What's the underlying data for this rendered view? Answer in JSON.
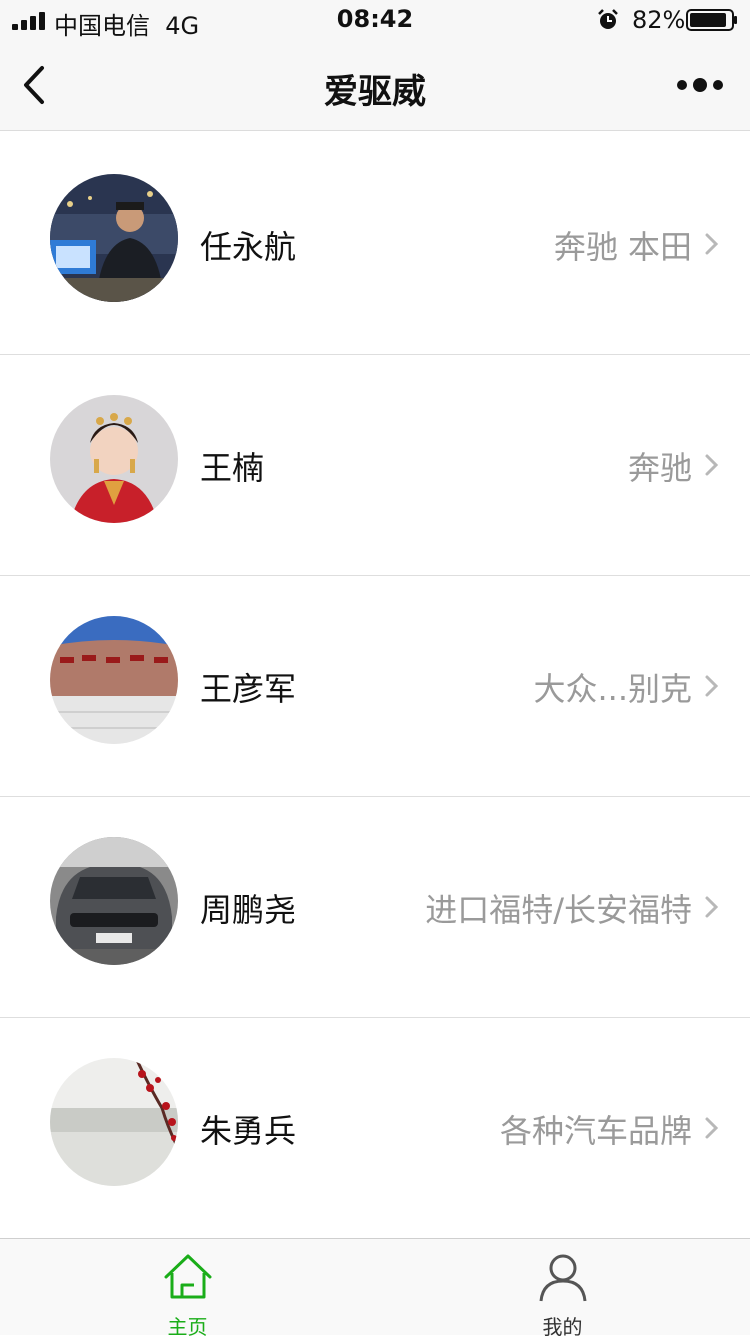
{
  "status_bar": {
    "carrier": "中国电信",
    "network": "4G",
    "time": "08:42",
    "battery": "82%"
  },
  "nav": {
    "title": "爱驱威",
    "back_icon": "chevron-left-icon",
    "more_icon": "more-dots-icon"
  },
  "dealers": [
    {
      "name": "任永航",
      "brands": "奔驰 本田"
    },
    {
      "name": "王楠",
      "brands": "奔驰"
    },
    {
      "name": "王彦军",
      "brands": "大众...别克"
    },
    {
      "name": "周鹏尧",
      "brands": "进口福特/长安福特"
    },
    {
      "name": "朱勇兵",
      "brands": "各种汽车品牌"
    }
  ],
  "tab_bar": {
    "home_label": "主页",
    "mine_label": "我的",
    "active_color": "#1aad19"
  }
}
